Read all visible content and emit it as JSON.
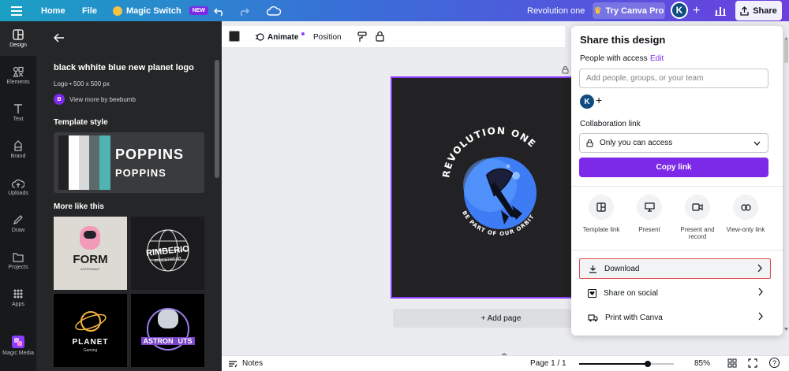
{
  "topbar": {
    "home": "Home",
    "file": "File",
    "magic_switch": "Magic Switch",
    "new_badge": "NEW",
    "project_title": "Revolution one",
    "try_pro": "Try Canva Pro",
    "avatar_letter": "K",
    "share": "Share"
  },
  "rail": {
    "items": [
      {
        "label": "Design"
      },
      {
        "label": "Elements"
      },
      {
        "label": "Text"
      },
      {
        "label": "Brand"
      },
      {
        "label": "Uploads"
      },
      {
        "label": "Draw"
      },
      {
        "label": "Projects"
      },
      {
        "label": "Apps"
      },
      {
        "label": "Magic Media"
      }
    ]
  },
  "panel": {
    "template_title": "black whhite blue new planet logo",
    "template_meta": "Logo • 500 x 500 px",
    "author_initial": "B",
    "author_link": "View more by beebumb",
    "template_style_heading": "Template style",
    "style_font_1": "POPPINS",
    "style_font_2": "POPPINS",
    "more_like_heading": "More like this",
    "thumbs": [
      {
        "text": "FORM",
        "sub": "ASTRONAUT"
      },
      {
        "text": "RIMBERIO",
        "sub": "STREETWEAR"
      },
      {
        "text": "PLANET",
        "sub": "Gaming"
      },
      {
        "text": "ASTRON",
        "sub": "UTS"
      }
    ]
  },
  "context_toolbar": {
    "animate": "Animate",
    "position": "Position"
  },
  "design": {
    "top_text": "REVOLUTION ONE",
    "bottom_text": "BE PART OF OUR ORBIT"
  },
  "canvas": {
    "add_page": "+ Add page"
  },
  "bottombar": {
    "notes": "Notes",
    "page": "Page 1 / 1",
    "zoom": "85%",
    "zoom_fraction": 0.85
  },
  "share_panel": {
    "title": "Share this design",
    "people_label": "People with access",
    "edit": "Edit",
    "add_placeholder": "Add people, groups, or your team",
    "owner_initial": "K",
    "collab_label": "Collaboration link",
    "access_value": "Only you can access",
    "copy_link": "Copy link",
    "options": [
      {
        "label": "Template link"
      },
      {
        "label": "Present"
      },
      {
        "label": "Present and record"
      },
      {
        "label": "View-only link"
      }
    ],
    "rows": [
      {
        "label": "Download"
      },
      {
        "label": "Share on social"
      },
      {
        "label": "Print with Canva"
      }
    ]
  },
  "colors": {
    "accent": "#7d2ae8",
    "panel_bg": "#252627",
    "rail_bg": "#18191b",
    "design_bg": "#222123",
    "rocket_blue": "#3d7cf5"
  }
}
